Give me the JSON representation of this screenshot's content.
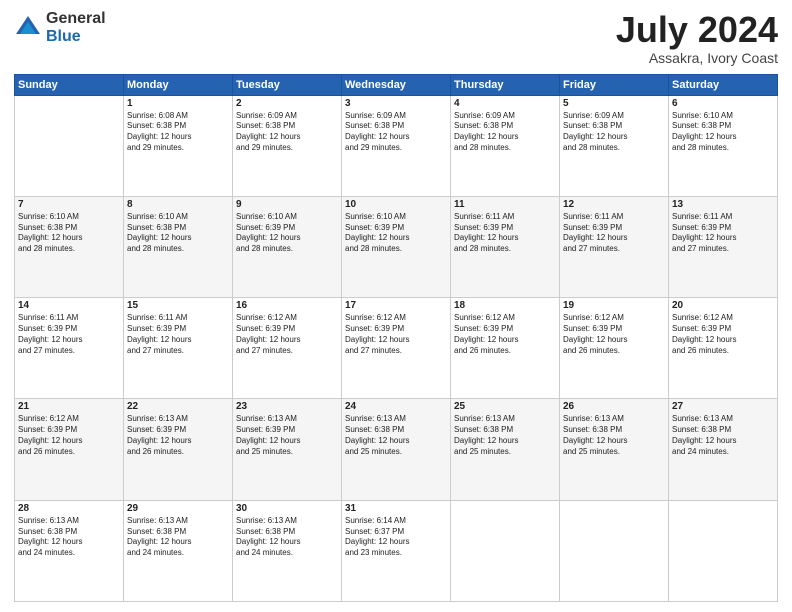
{
  "header": {
    "logo_general": "General",
    "logo_blue": "Blue",
    "month_title": "July 2024",
    "location": "Assakra, Ivory Coast"
  },
  "weekdays": [
    "Sunday",
    "Monday",
    "Tuesday",
    "Wednesday",
    "Thursday",
    "Friday",
    "Saturday"
  ],
  "weeks": [
    [
      {
        "day": "",
        "sunrise": "",
        "sunset": "",
        "daylight": ""
      },
      {
        "day": "1",
        "sunrise": "6:08 AM",
        "sunset": "6:38 PM",
        "daylight": "12 hours and 29 minutes."
      },
      {
        "day": "2",
        "sunrise": "6:09 AM",
        "sunset": "6:38 PM",
        "daylight": "12 hours and 29 minutes."
      },
      {
        "day": "3",
        "sunrise": "6:09 AM",
        "sunset": "6:38 PM",
        "daylight": "12 hours and 29 minutes."
      },
      {
        "day": "4",
        "sunrise": "6:09 AM",
        "sunset": "6:38 PM",
        "daylight": "12 hours and 28 minutes."
      },
      {
        "day": "5",
        "sunrise": "6:09 AM",
        "sunset": "6:38 PM",
        "daylight": "12 hours and 28 minutes."
      },
      {
        "day": "6",
        "sunrise": "6:10 AM",
        "sunset": "6:38 PM",
        "daylight": "12 hours and 28 minutes."
      }
    ],
    [
      {
        "day": "7",
        "sunrise": "6:10 AM",
        "sunset": "6:38 PM",
        "daylight": "12 hours and 28 minutes."
      },
      {
        "day": "8",
        "sunrise": "6:10 AM",
        "sunset": "6:38 PM",
        "daylight": "12 hours and 28 minutes."
      },
      {
        "day": "9",
        "sunrise": "6:10 AM",
        "sunset": "6:39 PM",
        "daylight": "12 hours and 28 minutes."
      },
      {
        "day": "10",
        "sunrise": "6:10 AM",
        "sunset": "6:39 PM",
        "daylight": "12 hours and 28 minutes."
      },
      {
        "day": "11",
        "sunrise": "6:11 AM",
        "sunset": "6:39 PM",
        "daylight": "12 hours and 28 minutes."
      },
      {
        "day": "12",
        "sunrise": "6:11 AM",
        "sunset": "6:39 PM",
        "daylight": "12 hours and 27 minutes."
      },
      {
        "day": "13",
        "sunrise": "6:11 AM",
        "sunset": "6:39 PM",
        "daylight": "12 hours and 27 minutes."
      }
    ],
    [
      {
        "day": "14",
        "sunrise": "6:11 AM",
        "sunset": "6:39 PM",
        "daylight": "12 hours and 27 minutes."
      },
      {
        "day": "15",
        "sunrise": "6:11 AM",
        "sunset": "6:39 PM",
        "daylight": "12 hours and 27 minutes."
      },
      {
        "day": "16",
        "sunrise": "6:12 AM",
        "sunset": "6:39 PM",
        "daylight": "12 hours and 27 minutes."
      },
      {
        "day": "17",
        "sunrise": "6:12 AM",
        "sunset": "6:39 PM",
        "daylight": "12 hours and 27 minutes."
      },
      {
        "day": "18",
        "sunrise": "6:12 AM",
        "sunset": "6:39 PM",
        "daylight": "12 hours and 26 minutes."
      },
      {
        "day": "19",
        "sunrise": "6:12 AM",
        "sunset": "6:39 PM",
        "daylight": "12 hours and 26 minutes."
      },
      {
        "day": "20",
        "sunrise": "6:12 AM",
        "sunset": "6:39 PM",
        "daylight": "12 hours and 26 minutes."
      }
    ],
    [
      {
        "day": "21",
        "sunrise": "6:12 AM",
        "sunset": "6:39 PM",
        "daylight": "12 hours and 26 minutes."
      },
      {
        "day": "22",
        "sunrise": "6:13 AM",
        "sunset": "6:39 PM",
        "daylight": "12 hours and 26 minutes."
      },
      {
        "day": "23",
        "sunrise": "6:13 AM",
        "sunset": "6:39 PM",
        "daylight": "12 hours and 25 minutes."
      },
      {
        "day": "24",
        "sunrise": "6:13 AM",
        "sunset": "6:38 PM",
        "daylight": "12 hours and 25 minutes."
      },
      {
        "day": "25",
        "sunrise": "6:13 AM",
        "sunset": "6:38 PM",
        "daylight": "12 hours and 25 minutes."
      },
      {
        "day": "26",
        "sunrise": "6:13 AM",
        "sunset": "6:38 PM",
        "daylight": "12 hours and 25 minutes."
      },
      {
        "day": "27",
        "sunrise": "6:13 AM",
        "sunset": "6:38 PM",
        "daylight": "12 hours and 24 minutes."
      }
    ],
    [
      {
        "day": "28",
        "sunrise": "6:13 AM",
        "sunset": "6:38 PM",
        "daylight": "12 hours and 24 minutes."
      },
      {
        "day": "29",
        "sunrise": "6:13 AM",
        "sunset": "6:38 PM",
        "daylight": "12 hours and 24 minutes."
      },
      {
        "day": "30",
        "sunrise": "6:13 AM",
        "sunset": "6:38 PM",
        "daylight": "12 hours and 24 minutes."
      },
      {
        "day": "31",
        "sunrise": "6:14 AM",
        "sunset": "6:37 PM",
        "daylight": "12 hours and 23 minutes."
      },
      {
        "day": "",
        "sunrise": "",
        "sunset": "",
        "daylight": ""
      },
      {
        "day": "",
        "sunrise": "",
        "sunset": "",
        "daylight": ""
      },
      {
        "day": "",
        "sunrise": "",
        "sunset": "",
        "daylight": ""
      }
    ]
  ]
}
